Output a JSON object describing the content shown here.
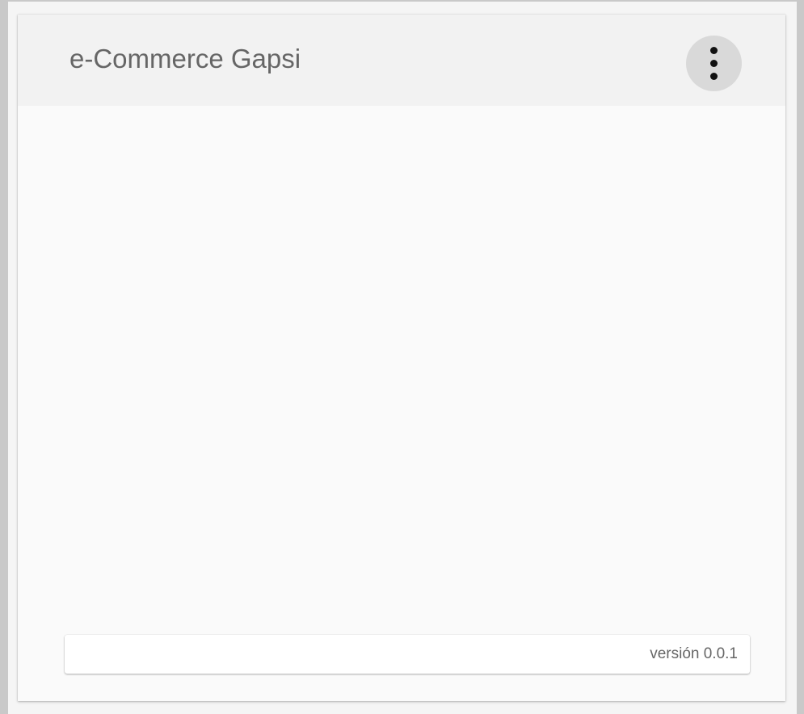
{
  "header": {
    "title": "e-Commerce Gapsi",
    "menu_icon": "more-vert-icon"
  },
  "footer": {
    "version": "versión 0.0.1"
  },
  "colors": {
    "header_background": "#f2f2f2",
    "content_background": "#fafafa",
    "title_text": "#666666",
    "menu_button_background": "#d9d9d9",
    "page_background": "#c9c9c9"
  }
}
